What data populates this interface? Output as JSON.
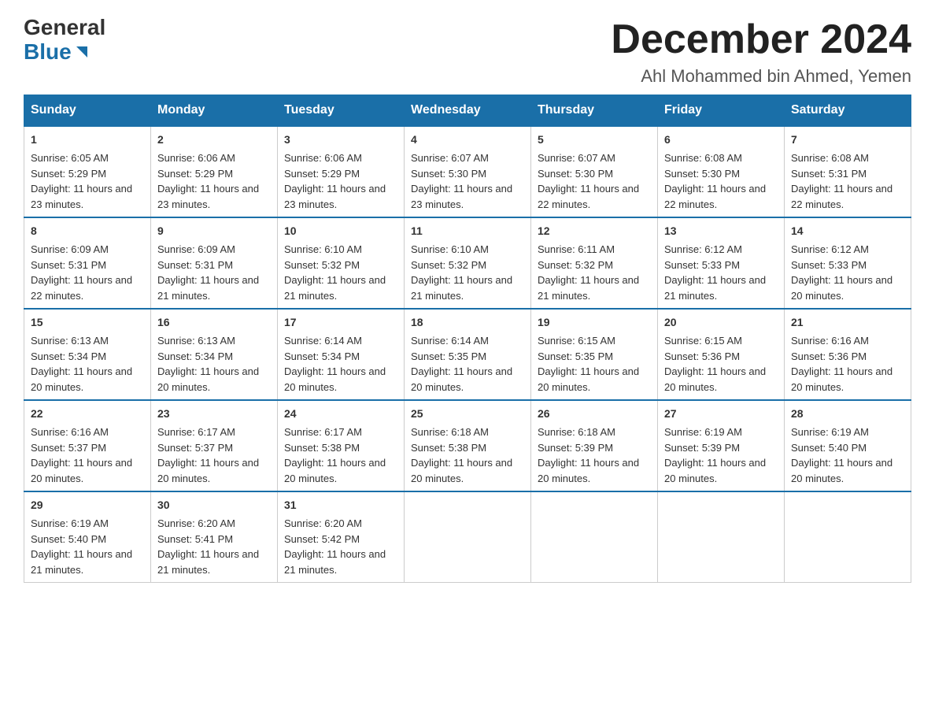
{
  "header": {
    "logo_general": "General",
    "logo_blue": "Blue",
    "month_title": "December 2024",
    "location": "Ahl Mohammed bin Ahmed, Yemen"
  },
  "days_of_week": [
    "Sunday",
    "Monday",
    "Tuesday",
    "Wednesday",
    "Thursday",
    "Friday",
    "Saturday"
  ],
  "weeks": [
    [
      {
        "day": "1",
        "sunrise": "6:05 AM",
        "sunset": "5:29 PM",
        "daylight": "11 hours and 23 minutes."
      },
      {
        "day": "2",
        "sunrise": "6:06 AM",
        "sunset": "5:29 PM",
        "daylight": "11 hours and 23 minutes."
      },
      {
        "day": "3",
        "sunrise": "6:06 AM",
        "sunset": "5:29 PM",
        "daylight": "11 hours and 23 minutes."
      },
      {
        "day": "4",
        "sunrise": "6:07 AM",
        "sunset": "5:30 PM",
        "daylight": "11 hours and 23 minutes."
      },
      {
        "day": "5",
        "sunrise": "6:07 AM",
        "sunset": "5:30 PM",
        "daylight": "11 hours and 22 minutes."
      },
      {
        "day": "6",
        "sunrise": "6:08 AM",
        "sunset": "5:30 PM",
        "daylight": "11 hours and 22 minutes."
      },
      {
        "day": "7",
        "sunrise": "6:08 AM",
        "sunset": "5:31 PM",
        "daylight": "11 hours and 22 minutes."
      }
    ],
    [
      {
        "day": "8",
        "sunrise": "6:09 AM",
        "sunset": "5:31 PM",
        "daylight": "11 hours and 22 minutes."
      },
      {
        "day": "9",
        "sunrise": "6:09 AM",
        "sunset": "5:31 PM",
        "daylight": "11 hours and 21 minutes."
      },
      {
        "day": "10",
        "sunrise": "6:10 AM",
        "sunset": "5:32 PM",
        "daylight": "11 hours and 21 minutes."
      },
      {
        "day": "11",
        "sunrise": "6:10 AM",
        "sunset": "5:32 PM",
        "daylight": "11 hours and 21 minutes."
      },
      {
        "day": "12",
        "sunrise": "6:11 AM",
        "sunset": "5:32 PM",
        "daylight": "11 hours and 21 minutes."
      },
      {
        "day": "13",
        "sunrise": "6:12 AM",
        "sunset": "5:33 PM",
        "daylight": "11 hours and 21 minutes."
      },
      {
        "day": "14",
        "sunrise": "6:12 AM",
        "sunset": "5:33 PM",
        "daylight": "11 hours and 20 minutes."
      }
    ],
    [
      {
        "day": "15",
        "sunrise": "6:13 AM",
        "sunset": "5:34 PM",
        "daylight": "11 hours and 20 minutes."
      },
      {
        "day": "16",
        "sunrise": "6:13 AM",
        "sunset": "5:34 PM",
        "daylight": "11 hours and 20 minutes."
      },
      {
        "day": "17",
        "sunrise": "6:14 AM",
        "sunset": "5:34 PM",
        "daylight": "11 hours and 20 minutes."
      },
      {
        "day": "18",
        "sunrise": "6:14 AM",
        "sunset": "5:35 PM",
        "daylight": "11 hours and 20 minutes."
      },
      {
        "day": "19",
        "sunrise": "6:15 AM",
        "sunset": "5:35 PM",
        "daylight": "11 hours and 20 minutes."
      },
      {
        "day": "20",
        "sunrise": "6:15 AM",
        "sunset": "5:36 PM",
        "daylight": "11 hours and 20 minutes."
      },
      {
        "day": "21",
        "sunrise": "6:16 AM",
        "sunset": "5:36 PM",
        "daylight": "11 hours and 20 minutes."
      }
    ],
    [
      {
        "day": "22",
        "sunrise": "6:16 AM",
        "sunset": "5:37 PM",
        "daylight": "11 hours and 20 minutes."
      },
      {
        "day": "23",
        "sunrise": "6:17 AM",
        "sunset": "5:37 PM",
        "daylight": "11 hours and 20 minutes."
      },
      {
        "day": "24",
        "sunrise": "6:17 AM",
        "sunset": "5:38 PM",
        "daylight": "11 hours and 20 minutes."
      },
      {
        "day": "25",
        "sunrise": "6:18 AM",
        "sunset": "5:38 PM",
        "daylight": "11 hours and 20 minutes."
      },
      {
        "day": "26",
        "sunrise": "6:18 AM",
        "sunset": "5:39 PM",
        "daylight": "11 hours and 20 minutes."
      },
      {
        "day": "27",
        "sunrise": "6:19 AM",
        "sunset": "5:39 PM",
        "daylight": "11 hours and 20 minutes."
      },
      {
        "day": "28",
        "sunrise": "6:19 AM",
        "sunset": "5:40 PM",
        "daylight": "11 hours and 20 minutes."
      }
    ],
    [
      {
        "day": "29",
        "sunrise": "6:19 AM",
        "sunset": "5:40 PM",
        "daylight": "11 hours and 21 minutes."
      },
      {
        "day": "30",
        "sunrise": "6:20 AM",
        "sunset": "5:41 PM",
        "daylight": "11 hours and 21 minutes."
      },
      {
        "day": "31",
        "sunrise": "6:20 AM",
        "sunset": "5:42 PM",
        "daylight": "11 hours and 21 minutes."
      },
      null,
      null,
      null,
      null
    ]
  ],
  "labels": {
    "sunrise": "Sunrise:",
    "sunset": "Sunset:",
    "daylight": "Daylight:"
  }
}
